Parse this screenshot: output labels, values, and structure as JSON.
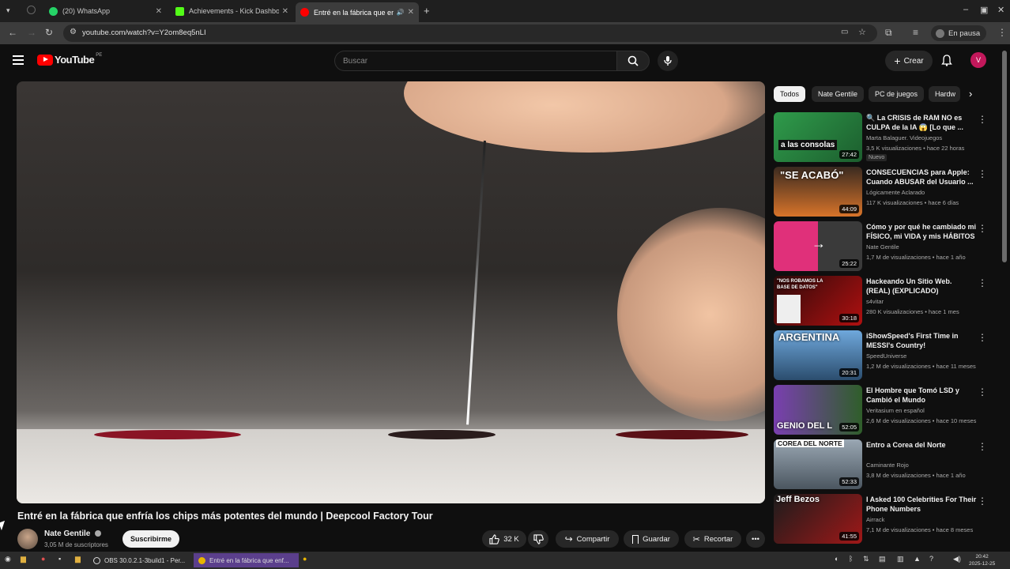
{
  "browser": {
    "tabs": [
      {
        "title": "(20) WhatsApp",
        "icon": "whatsapp-icon",
        "color": "#25d366"
      },
      {
        "title": "Achievements - Kick Dashbo",
        "icon": "kick-icon",
        "color": "#53fc18"
      },
      {
        "title": "Entré en la fábrica que enfr",
        "icon": "youtube-icon",
        "color": "#ff0000"
      }
    ],
    "url": "youtube.com/watch?v=Y2om8eq5nLI",
    "profile_label": "En pausa"
  },
  "header": {
    "logo_text": "YouTube",
    "country_code": "PE",
    "search_placeholder": "Buscar",
    "create_label": "Crear",
    "avatar_letter": "V"
  },
  "video": {
    "title": "Entré en la fábrica que enfría los chips más potentes del mundo | Deepcool Factory Tour",
    "channel": "Nate Gentile",
    "subscribers": "3,05 M de suscriptores",
    "subscribe_label": "Suscribirme",
    "likes": "32 K",
    "share_label": "Compartir",
    "save_label": "Guardar",
    "clip_label": "Recortar"
  },
  "chips": [
    "Todos",
    "Nate Gentile",
    "PC de juegos",
    "Hardw"
  ],
  "recommendations": [
    {
      "title": "🔍 La CRISIS de RAM NO es CULPA de la IA 😱 [Lo que ...",
      "channel": "Marta Balaguer. Videojuegos",
      "meta": "3,5 K visualizaciones • hace 22 horas",
      "badge": "Nuevo",
      "duration": "27:42",
      "thumb_text": "a las consolas",
      "colors": [
        "#2f9b4b",
        "#1c5e2e"
      ]
    },
    {
      "title": "CONSECUENCIAS para Apple: Cuando ABUSAR del Usuario ...",
      "channel": "Lógicamente Aclarado",
      "meta": "117 K visualizaciones • hace 6 días",
      "badge": "",
      "duration": "44:09",
      "thumb_text": "\"SE ACABÓ\"",
      "colors": [
        "#d8742a",
        "#3a2a20"
      ]
    },
    {
      "title": "Cómo y por qué he cambiado mi FÍSICO, mi VIDA y mis HÁBITOS",
      "channel": "Nate Gentile",
      "meta": "1,7 M de visualizaciones • hace 1 año",
      "badge": "",
      "duration": "25:22",
      "thumb_text": "",
      "colors": [
        "#e0307a",
        "#3a3a3a"
      ]
    },
    {
      "title": "Hackeando Un Sitio Web. (REAL) (EXPLICADO)",
      "channel": "s4vitar",
      "meta": "280 K visualizaciones • hace 1 mes",
      "badge": "",
      "duration": "30:18",
      "thumb_text": "\"NOS ROBAMOS LA BASE DE DATOS\"",
      "colors": [
        "#b01010",
        "#2a0a0a"
      ]
    },
    {
      "title": "iShowSpeed's First Time in MESSI's Country!",
      "channel": "SpeedUniverse",
      "meta": "1,2 M de visualizaciones • hace 11 meses",
      "badge": "",
      "duration": "20:31",
      "thumb_text": "ARGENTINA",
      "colors": [
        "#6fa8dc",
        "#2b4d6e"
      ]
    },
    {
      "title": "El Hombre que Tomó LSD y Cambió el Mundo",
      "channel": "Veritasium en español",
      "meta": "2,6 M de visualizaciones • hace 10 meses",
      "badge": "",
      "duration": "52:05",
      "thumb_text": "GENIO DEL L",
      "colors": [
        "#7a3fb0",
        "#2f5e2a"
      ]
    },
    {
      "title": "Entro a Corea del Norte",
      "channel": "Caminante Rojo",
      "meta": "3,8 M de visualizaciones • hace 1 año",
      "badge": "",
      "duration": "52:33",
      "thumb_text": "COREA DEL NORTE",
      "colors": [
        "#9aa7b3",
        "#4b5660"
      ]
    },
    {
      "title": "I Asked 100 Celebrities For Their Phone Numbers",
      "channel": "Airrack",
      "meta": "7,1 M de visualizaciones • hace 8 meses",
      "badge": "",
      "duration": "41:55",
      "thumb_text": "Jeff Bezos",
      "colors": [
        "#a01818",
        "#1c1c1c"
      ]
    }
  ],
  "taskbar": {
    "items": [
      "OBS 30.0.2.1-3build1 - Per...",
      "Entré en la fábrica que enf..."
    ],
    "time": "20:42",
    "date": "2025-12-25"
  }
}
